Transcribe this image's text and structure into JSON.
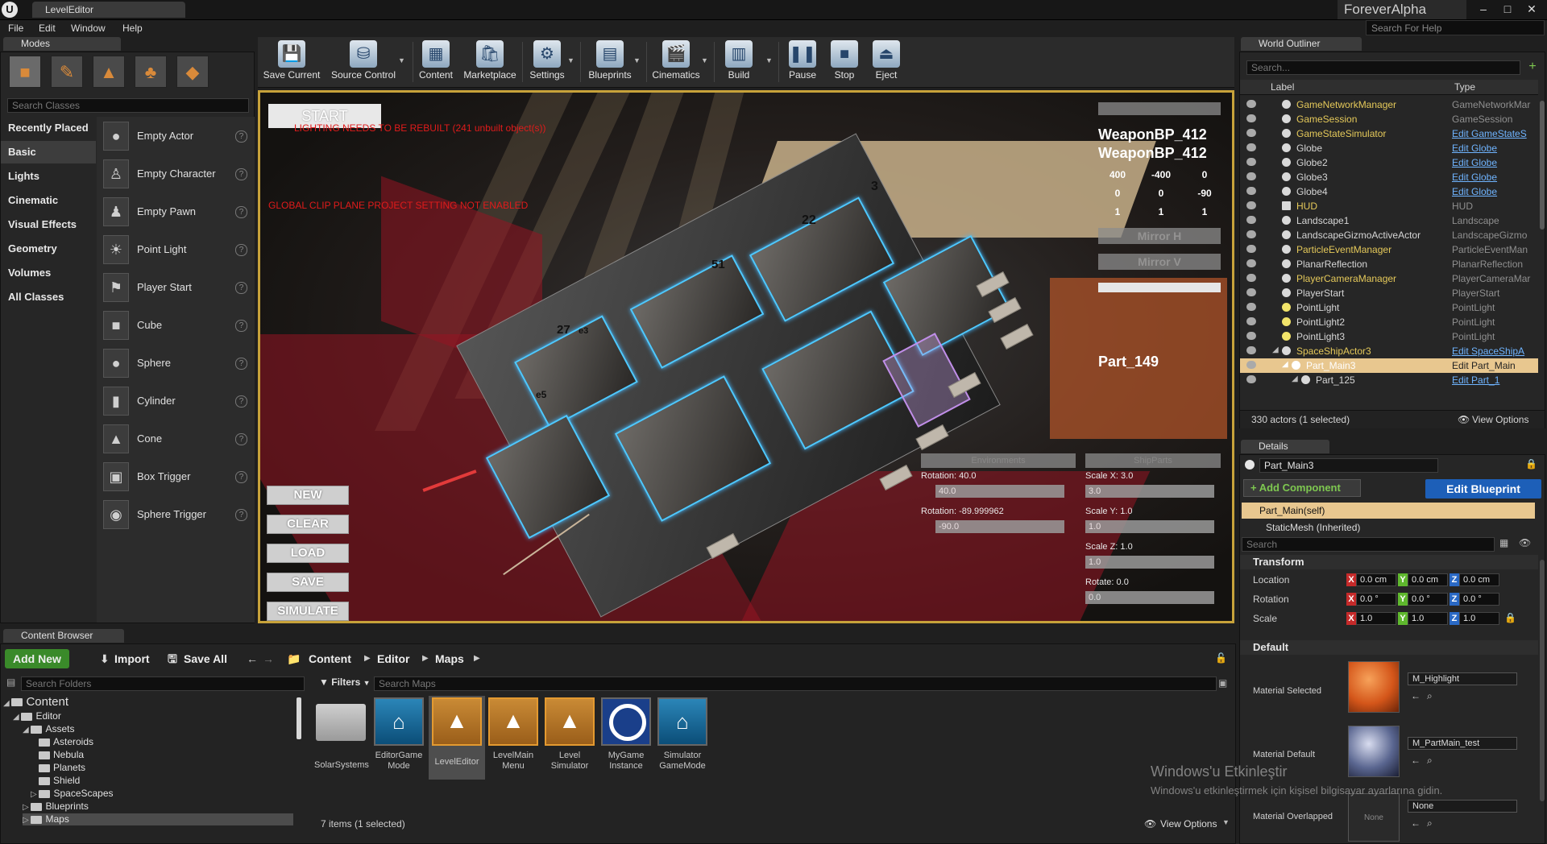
{
  "window": {
    "tab": "LevelEditor",
    "project": "ForeverAlpha",
    "search_help_placeholder": "Search For Help"
  },
  "menu": [
    "File",
    "Edit",
    "Window",
    "Help"
  ],
  "modes": {
    "tab": "Modes",
    "search_placeholder": "Search Classes",
    "categories": [
      "Recently Placed",
      "Basic",
      "Lights",
      "Cinematic",
      "Visual Effects",
      "Geometry",
      "Volumes",
      "All Classes"
    ],
    "active_category": "Basic",
    "items": [
      "Empty Actor",
      "Empty Character",
      "Empty Pawn",
      "Point Light",
      "Player Start",
      "Cube",
      "Sphere",
      "Cylinder",
      "Cone",
      "Box Trigger",
      "Sphere Trigger"
    ]
  },
  "toolbar": {
    "buttons": [
      "Save Current",
      "Source Control",
      "Content",
      "Marketplace",
      "Settings",
      "Blueprints",
      "Cinematics",
      "Build",
      "Pause",
      "Stop",
      "Eject"
    ]
  },
  "viewport": {
    "start": "START",
    "warning_lighting": "LIGHTING NEEDS TO BE REBUILT (241 unbuilt object(s))",
    "warning_clip": "GLOBAL CLIP PLANE PROJECT SETTING NOT ENABLED",
    "weapon1": "WeaponBP_412",
    "weapon2": "WeaponBP_412",
    "grid_rows": [
      [
        "400",
        "-400",
        "0"
      ],
      [
        "0",
        "0",
        "-90"
      ],
      [
        "1",
        "1",
        "1"
      ]
    ],
    "mirror_h": "Mirror H",
    "mirror_v": "Mirror V",
    "part": "Part_149",
    "buttons": [
      "NEW",
      "CLEAR",
      "LOAD",
      "SAVE",
      "SIMULATE"
    ],
    "tab_env": "Environments",
    "tab_ship": "ShipParts",
    "rotation_label1": "Rotation: 40.0",
    "rotation_field1": "40.0",
    "rotation_label2": "Rotation: -89.999962",
    "rotation_field2": "-90.0",
    "scale_x_label": "Scale X: 3.0",
    "scale_x_field": "3.0",
    "scale_y_label": "Scale Y: 1.0",
    "scale_y_field": "1.0",
    "scale_z_label": "Scale Z: 1.0",
    "scale_z_field": "1.0",
    "rotate_label": "Rotate: 0.0",
    "rotate_field": "0.0",
    "labels_3d": [
      "3",
      "22",
      "51",
      "27",
      "e5",
      "e3"
    ]
  },
  "outliner": {
    "tab": "World Outliner",
    "search_placeholder": "Search...",
    "col_label": "Label",
    "col_type": "Type",
    "rows": [
      {
        "name": "GameNetworkManager",
        "type": "GameNetworkMar",
        "link": false
      },
      {
        "name": "GameSession",
        "type": "GameSession",
        "link": false
      },
      {
        "name": "GameStateSimulator",
        "type": "Edit GameStateS",
        "link": true
      },
      {
        "name": "Globe",
        "type": "Edit Globe",
        "link": true
      },
      {
        "name": "Globe2",
        "type": "Edit Globe",
        "link": true
      },
      {
        "name": "Globe3",
        "type": "Edit Globe",
        "link": true
      },
      {
        "name": "Globe4",
        "type": "Edit Globe",
        "link": true
      },
      {
        "name": "HUD",
        "type": "HUD",
        "link": false
      },
      {
        "name": "Landscape1",
        "type": "Landscape",
        "link": false
      },
      {
        "name": "LandscapeGizmoActiveActor",
        "type": "LandscapeGizmo",
        "link": false
      },
      {
        "name": "ParticleEventManager",
        "type": "ParticleEventMan",
        "link": false
      },
      {
        "name": "PlanarReflection",
        "type": "PlanarReflection",
        "link": false
      },
      {
        "name": "PlayerCameraManager",
        "type": "PlayerCameraMar",
        "link": false
      },
      {
        "name": "PlayerStart",
        "type": "PlayerStart",
        "link": false
      },
      {
        "name": "PointLight",
        "type": "PointLight",
        "link": false
      },
      {
        "name": "PointLight2",
        "type": "PointLight",
        "link": false
      },
      {
        "name": "PointLight3",
        "type": "PointLight",
        "link": false
      },
      {
        "name": "SpaceShipActor3",
        "type": "Edit SpaceShipA",
        "link": true
      },
      {
        "name": "Part_Main3",
        "type": "Edit Part_Main",
        "link": true
      },
      {
        "name": "Part_125",
        "type": "Edit Part_1",
        "link": true
      }
    ],
    "status": "330 actors (1 selected)",
    "view_options": "View Options"
  },
  "details": {
    "tab": "Details",
    "name": "Part_Main3",
    "add_component": "+ Add Component",
    "edit_blueprint": "Edit Blueprint",
    "component_self": "Part_Main(self)",
    "component_mesh": "StaticMesh (Inherited)",
    "search_placeholder": "Search",
    "transform": "Transform",
    "location": "Location",
    "rotation": "Rotation",
    "scale": "Scale",
    "location_vals": [
      "0.0 cm",
      "0.0 cm",
      "0.0 cm"
    ],
    "rotation_vals": [
      "0.0 °",
      "0.0 °",
      "0.0 °"
    ],
    "scale_vals": [
      "1.0",
      "1.0",
      "1.0"
    ],
    "default": "Default",
    "mat_selected_label": "Material Selected",
    "mat_selected_value": "M_Highlight",
    "mat_default_label": "Material Default",
    "mat_default_value": "M_PartMain_test",
    "mat_overlapped_label": "Material Overlapped",
    "mat_overlapped_thumb": "None",
    "mat_overlapped_value": "None"
  },
  "content_browser": {
    "tab": "Content Browser",
    "add_new": "Add New",
    "import": "Import",
    "save_all": "Save All",
    "path": [
      "Content",
      "Editor",
      "Maps"
    ],
    "search_folders": "Search Folders",
    "filters": "Filters",
    "search_maps": "Search Maps",
    "tree": [
      {
        "label": "Content",
        "level": 0
      },
      {
        "label": "Editor",
        "level": 1
      },
      {
        "label": "Assets",
        "level": 2
      },
      {
        "label": "Asteroids",
        "level": 3
      },
      {
        "label": "Nebula",
        "level": 3
      },
      {
        "label": "Planets",
        "level": 3
      },
      {
        "label": "Shield",
        "level": 3
      },
      {
        "label": "SpaceScapes",
        "level": 3
      },
      {
        "label": "Blueprints",
        "level": 2
      },
      {
        "label": "Maps",
        "level": 2
      }
    ],
    "assets": [
      "SolarSystems",
      "EditorGame Mode",
      "LevelEditor",
      "LevelMain Menu",
      "Level Simulator",
      "MyGame Instance",
      "Simulator GameMode"
    ],
    "status": "7 items (1 selected)",
    "view_options": "View Options"
  },
  "watermark": {
    "title": "Windows'u Etkinleştir",
    "sub": "Windows'u etkinleştirmek için kişisel bilgisayar ayarlarına gidin."
  }
}
